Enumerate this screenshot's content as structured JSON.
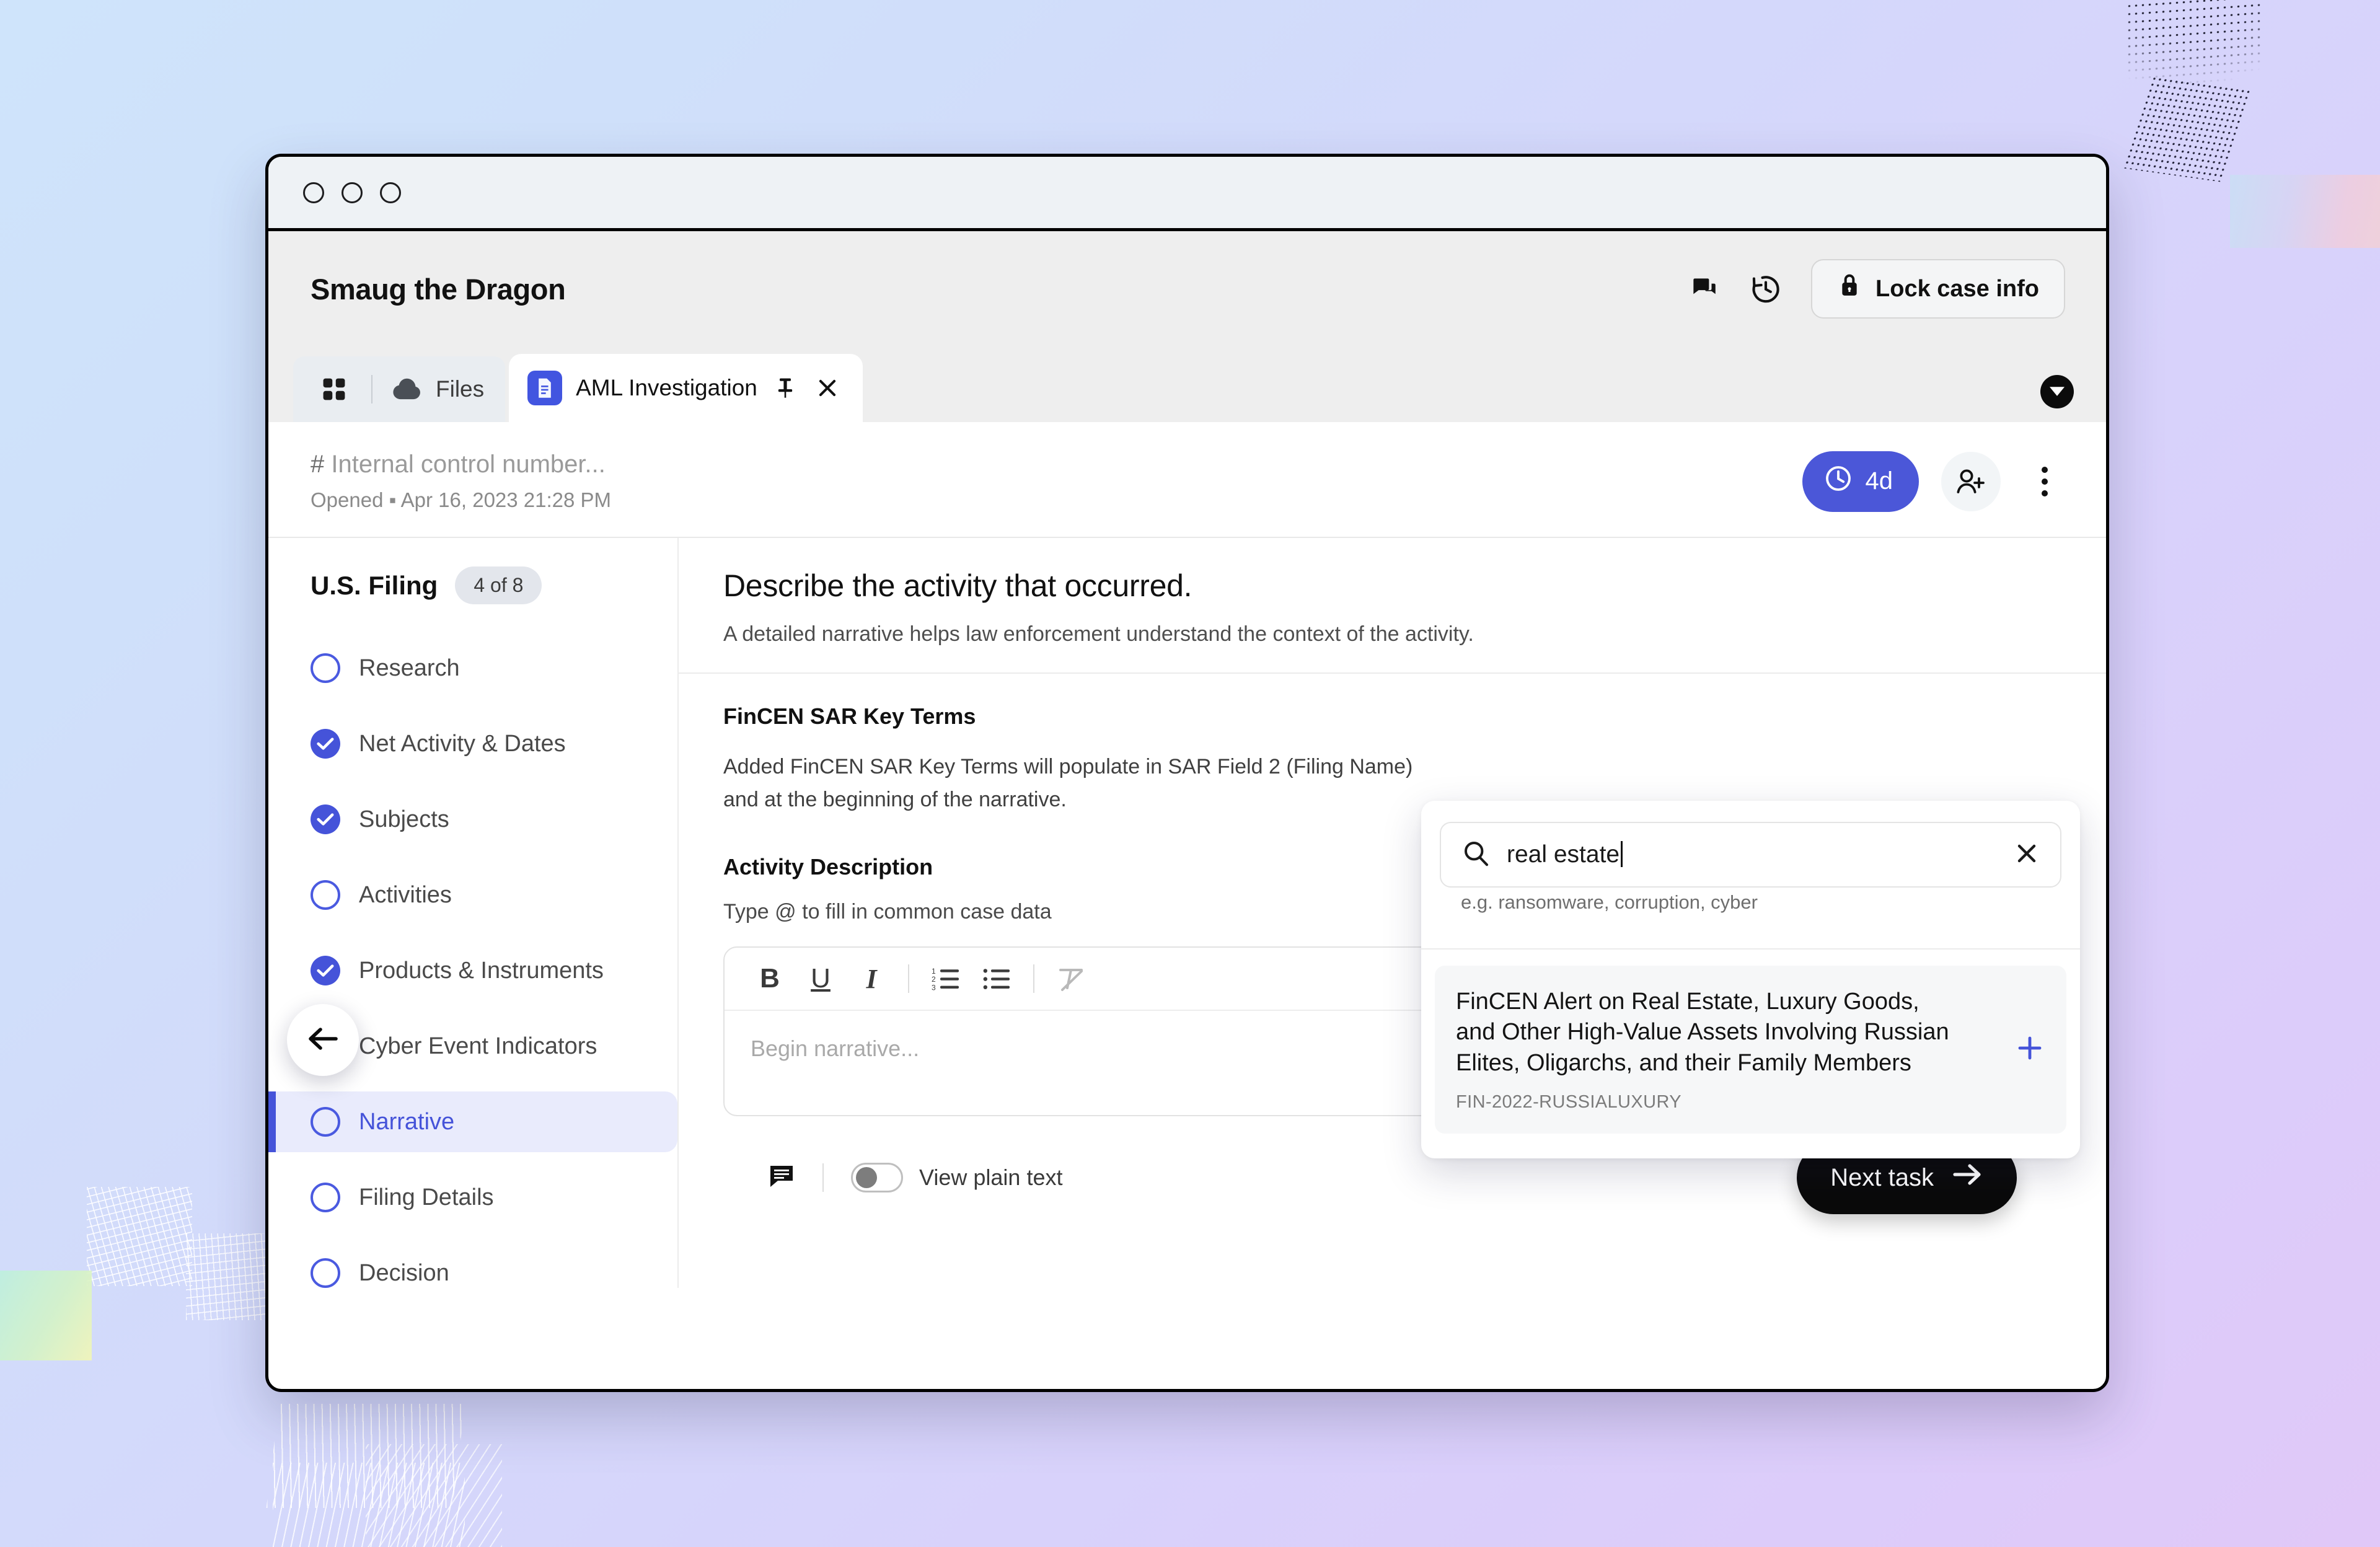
{
  "window": {
    "traffic_lights": [
      "close",
      "minimize",
      "maximize"
    ]
  },
  "header": {
    "title": "Smaug the Dragon",
    "comments_icon": "comments-icon",
    "history_icon": "history-icon",
    "lock_button": "Lock case info",
    "lock_icon": "lock-icon"
  },
  "tabs": {
    "grid_icon": "grid-icon",
    "files_label": "Files",
    "files_icon": "cloud-icon",
    "active_tab_label": "AML Investigation",
    "active_tab_icon": "document-icon",
    "pin_icon": "pin-icon",
    "close_icon": "close-icon",
    "overflow_icon": "chevron-down-icon"
  },
  "case": {
    "control_number_placeholder": "Internal control number...",
    "hash": "#",
    "opened": "Opened ▪ Apr 16, 2023 21:28 PM",
    "sla_badge": "4d",
    "sla_icon": "clock-icon",
    "add_user_icon": "add-user-icon",
    "more_icon": "kebab-menu-icon"
  },
  "sidebar": {
    "title": "U.S. Filing",
    "count": "4 of 8",
    "items": [
      {
        "label": "Research",
        "state": "incomplete"
      },
      {
        "label": "Net Activity & Dates",
        "state": "complete"
      },
      {
        "label": "Subjects",
        "state": "complete"
      },
      {
        "label": "Activities",
        "state": "incomplete"
      },
      {
        "label": "Products & Instruments",
        "state": "complete"
      },
      {
        "label": "Cyber Event Indicators",
        "state": "complete"
      },
      {
        "label": "Narrative",
        "state": "selected"
      },
      {
        "label": "Filing Details",
        "state": "incomplete"
      },
      {
        "label": "Decision",
        "state": "incomplete"
      }
    ],
    "back_icon": "arrow-left-icon"
  },
  "main": {
    "question_title": "Describe the activity that occurred.",
    "question_subtitle": "A detailed narrative helps law enforcement understand the context of the activity.",
    "key_terms_title": "FinCEN SAR Key Terms",
    "key_terms_para": "Added FinCEN SAR Key Terms will populate in SAR Field 2 (Filing Name) and at the beginning of the narrative.",
    "activity_title": "Activity Description",
    "activity_hint": "Type @ to fill in common case data",
    "toolbar": {
      "bold": "B",
      "underline": "U",
      "italic": "I",
      "ordered_list": "ordered-list-icon",
      "bullet_list": "bullet-list-icon",
      "clear_format": "clear-formatting-icon"
    },
    "editor_placeholder": "Begin narrative...",
    "plain_text_label": "View plain text",
    "plain_text_state": "off",
    "comment_icon": "comment-icon",
    "next_task_label": "Next task",
    "next_task_icon": "arrow-right-icon"
  },
  "search_popup": {
    "search_icon": "search-icon",
    "query": "real estate",
    "clear_icon": "close-icon",
    "hint": "e.g. ransomware, corruption, cyber",
    "results": [
      {
        "title": "FinCEN Alert on Real Estate, Luxury Goods, and Other High-Value Assets Involving Russian Elites, Oligarchs, and their Family Members",
        "code": "FIN-2022-RUSSIALUXURY",
        "add_icon": "plus-icon"
      }
    ]
  },
  "colors": {
    "accent": "#4553d9",
    "accent_soft": "#e9ebfc",
    "dark": "#0a0a0a",
    "muted": "#7b7b7b"
  }
}
